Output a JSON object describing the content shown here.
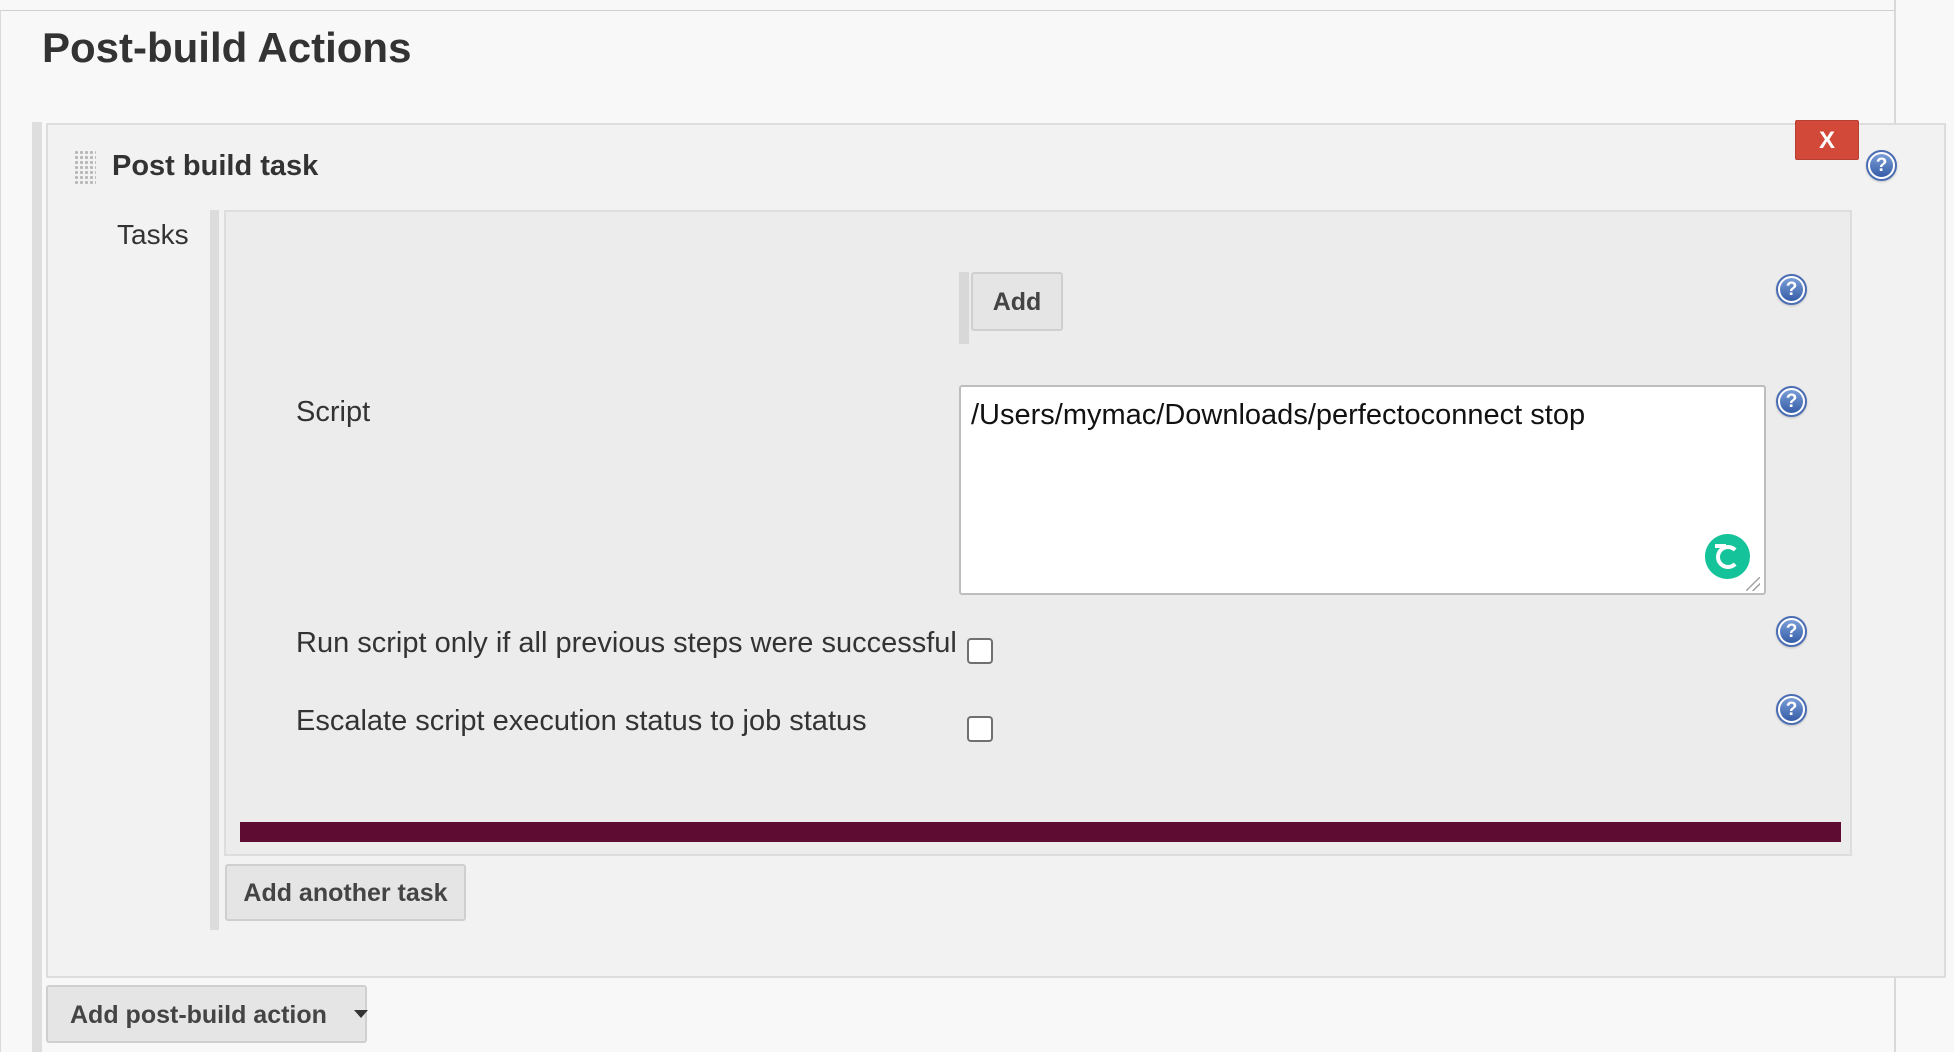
{
  "header": {
    "title": "Post-build Actions"
  },
  "post_build_task": {
    "title": "Post build task",
    "delete_label": "X",
    "tasks_label": "Tasks",
    "add_label": "Add",
    "script_label": "Script",
    "script_value": "/Users/mymac/Downloads/perfectoconnect stop",
    "run_only_label": "Run script only if all previous steps were successful",
    "run_only_checked": false,
    "escalate_label": "Escalate script execution status to job status",
    "escalate_checked": false,
    "add_task_label": "Add another task"
  },
  "footer": {
    "add_action_label": "Add post-build action"
  },
  "icons": {
    "help": "help-icon",
    "grammarly": "grammarly-icon",
    "drag": "drag-handle-icon",
    "dropdown": "chevron-down-icon"
  },
  "colors": {
    "delete_button": "#d24939",
    "accent_bar": "#5e0c31",
    "help_icon": "#355da8",
    "grammarly": "#15c39a"
  }
}
